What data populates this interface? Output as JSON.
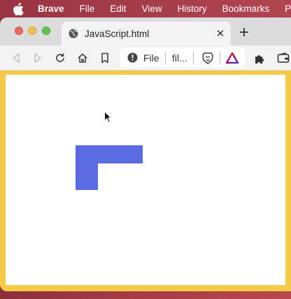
{
  "menubar": {
    "app_name": "Brave",
    "items": [
      "File",
      "Edit",
      "View",
      "History",
      "Bookmarks",
      "Pr"
    ]
  },
  "tab": {
    "title": "JavaScript.html",
    "close_glyph": "✕"
  },
  "urlbar": {
    "scheme_label": "File",
    "path": "fil..."
  },
  "colors": {
    "page_frame": "#f6ca45",
    "shape_fill": "#5b6be0",
    "menubar_bg": "#a23a46"
  },
  "icons": [
    "apple-icon",
    "globe-icon",
    "close-icon",
    "plus-icon",
    "back-icon",
    "forward-icon",
    "reload-icon",
    "home-icon",
    "bookmark-icon",
    "warning-icon",
    "brave-shields-icon",
    "brave-rewards-icon",
    "extensions-icon",
    "wallet-icon",
    "mouse-cursor-icon"
  ]
}
